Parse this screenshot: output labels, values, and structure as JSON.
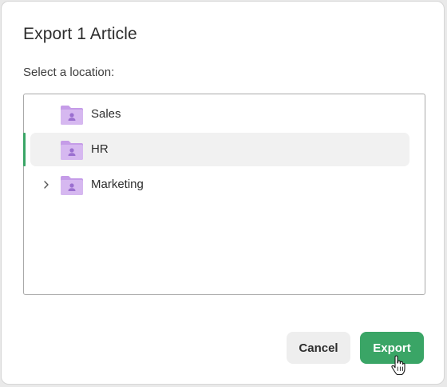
{
  "dialog": {
    "title": "Export 1 Article",
    "prompt": "Select a location:"
  },
  "tree": {
    "items": [
      {
        "label": "Sales",
        "icon": "folder-user-icon",
        "expandable": false,
        "selected": false
      },
      {
        "label": "HR",
        "icon": "folder-user-icon",
        "expandable": false,
        "selected": true
      },
      {
        "label": "Marketing",
        "icon": "folder-user-icon",
        "expandable": true,
        "selected": false
      }
    ]
  },
  "buttons": {
    "cancel_label": "Cancel",
    "export_label": "Export"
  },
  "colors": {
    "accent": "#3aa566",
    "folder": "#d6b8f0",
    "folder_tab": "#c59ce8",
    "folder_person": "#9b6fd0",
    "selected_row": "#f1f1f1"
  }
}
